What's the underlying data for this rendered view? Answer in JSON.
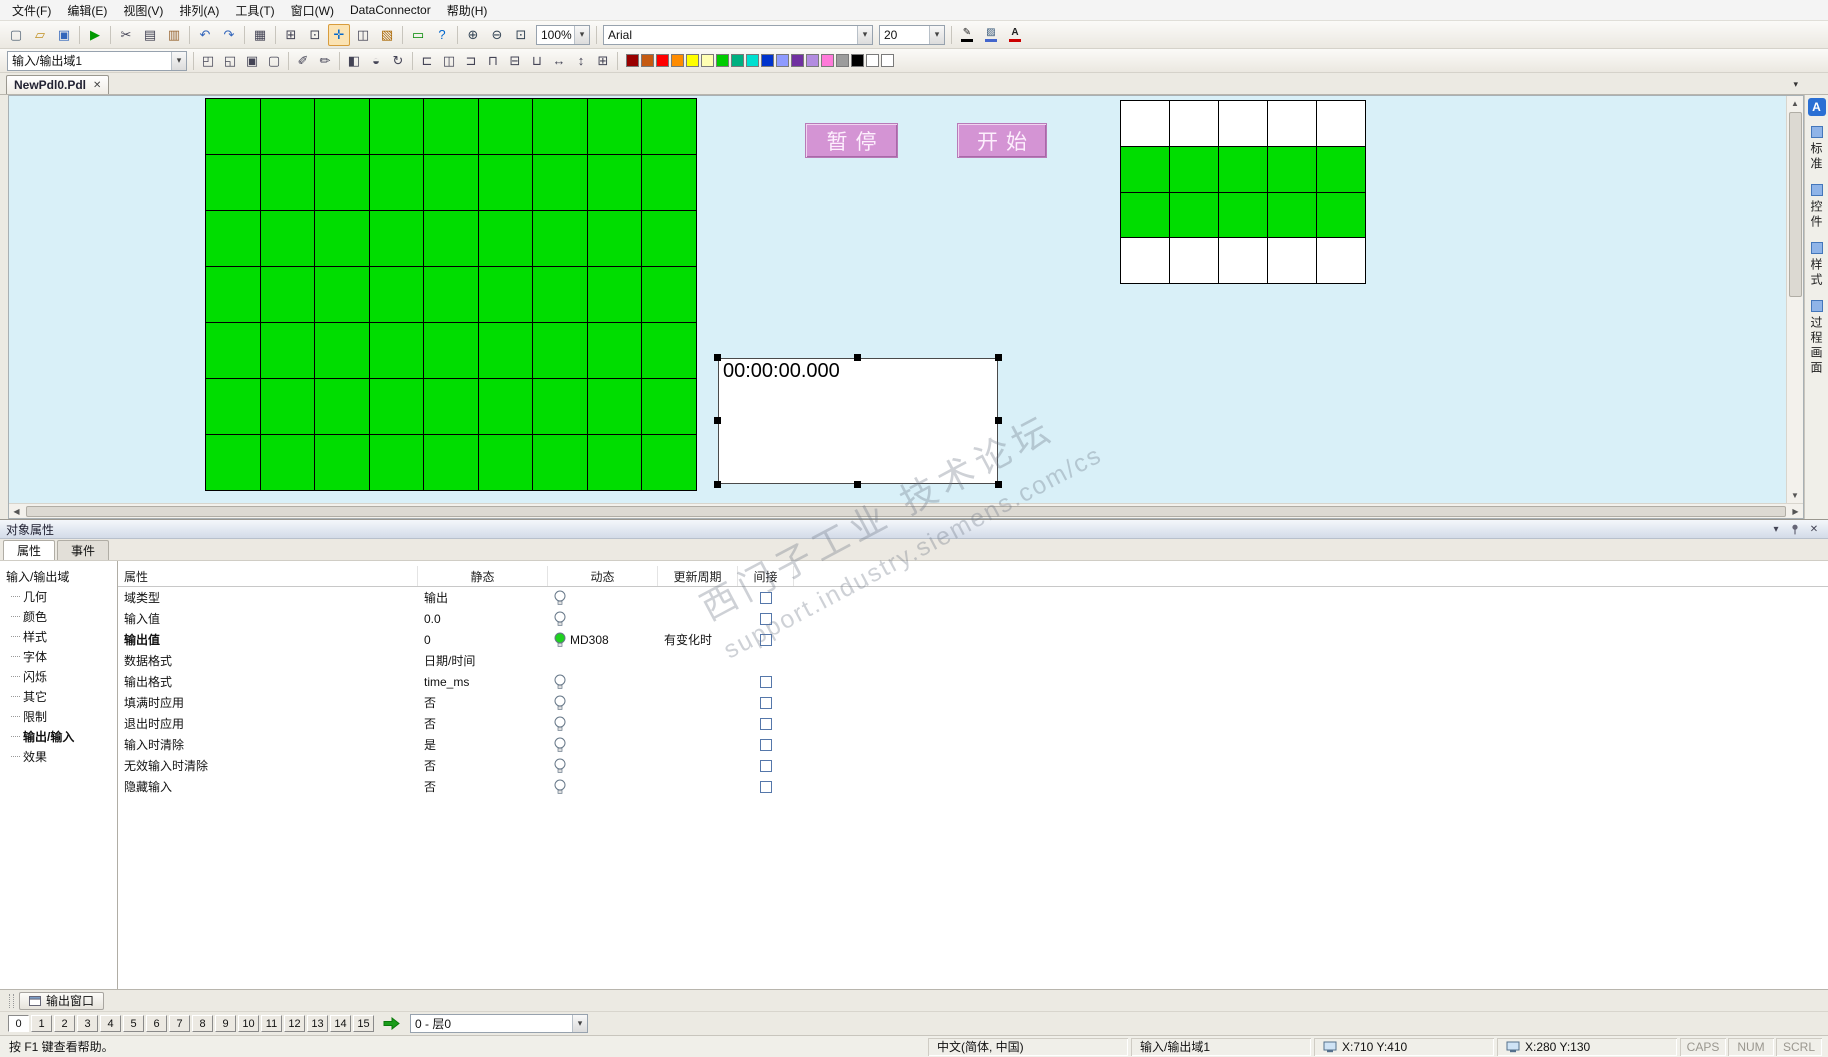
{
  "icons": {
    "close": "✕",
    "chevron_down": "▾",
    "scroll_up": "▲",
    "scroll_down": "▼",
    "scroll_left": "◀",
    "scroll_right": "▶",
    "standard_palette_letter": "A"
  },
  "menu_bar": {
    "items": [
      "文件(F)",
      "编辑(E)",
      "视图(V)",
      "排列(A)",
      "工具(T)",
      "窗口(W)",
      "DataConnector",
      "帮助(H)"
    ]
  },
  "toolbar_main": {
    "zoom_value": "100%",
    "font_name": "Arial",
    "font_size": "20",
    "icons": [
      {
        "n": "new-file-icon",
        "k": "new-file"
      },
      {
        "n": "open-file-icon",
        "k": "open-file"
      },
      {
        "n": "save-icon",
        "k": "save"
      },
      {
        "sep": 1
      },
      {
        "n": "run-icon",
        "k": "run"
      },
      {
        "sep": 1
      },
      {
        "n": "cut-icon",
        "k": "cut"
      },
      {
        "n": "copy-icon",
        "k": "copy"
      },
      {
        "n": "paste-icon",
        "k": "paste"
      },
      {
        "sep": 1
      },
      {
        "n": "undo-icon",
        "k": "undo"
      },
      {
        "n": "redo-icon",
        "k": "redo"
      },
      {
        "sep": 1
      },
      {
        "n": "print-icon",
        "k": "print"
      },
      {
        "sep": 1
      },
      {
        "n": "grid-icon",
        "k": "grid"
      },
      {
        "n": "snap-grid-icon",
        "k": "snap-grid"
      },
      {
        "n": "select-tool-icon",
        "k": "select-tool",
        "active": 1
      },
      {
        "n": "layout-panels-icon",
        "k": "panels"
      },
      {
        "n": "library-icon",
        "k": "library"
      },
      {
        "sep": 1
      },
      {
        "n": "tag-icon",
        "k": "tag"
      },
      {
        "n": "help-pointer-icon",
        "k": "help"
      },
      {
        "sep": 1
      },
      {
        "n": "zoom-in-icon",
        "k": "zoom-in"
      },
      {
        "n": "zoom-out-icon",
        "k": "zoom-out"
      },
      {
        "n": "zoom-area-icon",
        "k": "zoom-area"
      },
      {
        "combo": "zoom"
      },
      {
        "sep": 1
      },
      {
        "combo": "font"
      },
      {
        "combo": "size"
      },
      {
        "sep": 1
      },
      {
        "n": "line-color-icon",
        "k": "pen"
      },
      {
        "n": "fill-color-icon",
        "k": "fill"
      },
      {
        "n": "font-color-icon",
        "k": "font-color"
      }
    ]
  },
  "toolbar_object": {
    "selected_object": "输入/输出域1",
    "palette_colors": [
      "#990000",
      "#c55a11",
      "#ff0000",
      "#ff8c00",
      "#ffff00",
      "#ffffb3",
      "#00cc00",
      "#00b080",
      "#00e0d0",
      "#0033cc",
      "#8f9bff",
      "#7030a0",
      "#b38ce0",
      "#ff7ad9",
      "#9c9c9c",
      "#000000",
      "#ffffff",
      "#ffffff"
    ],
    "icons": [
      {
        "combo": "object"
      },
      {
        "sep": 1
      },
      {
        "n": "bring-front-icon",
        "k": "bring-front"
      },
      {
        "n": "send-back-icon",
        "k": "send-back"
      },
      {
        "n": "group-icon",
        "k": "group"
      },
      {
        "n": "ungroup-icon",
        "k": "ungroup"
      },
      {
        "sep": 1
      },
      {
        "n": "pipette-icon",
        "k": "pipette"
      },
      {
        "n": "brush-icon",
        "k": "brush"
      },
      {
        "sep": 1
      },
      {
        "n": "flip-horizontal-icon",
        "k": "flip-h"
      },
      {
        "n": "flip-vertical-icon",
        "k": "flip-v"
      },
      {
        "n": "rotate-icon",
        "k": "rotate"
      },
      {
        "sep": 1
      },
      {
        "n": "align-left-icon",
        "k": "align-left"
      },
      {
        "n": "align-center-icon",
        "k": "align-center"
      },
      {
        "n": "align-right-icon",
        "k": "align-right"
      },
      {
        "n": "align-top-icon",
        "k": "align-top"
      },
      {
        "n": "align-middle-icon",
        "k": "align-middle"
      },
      {
        "n": "align-bottom-icon",
        "k": "align-bottom"
      },
      {
        "n": "same-width-icon",
        "k": "same-width"
      },
      {
        "n": "same-height-icon",
        "k": "same-height"
      },
      {
        "n": "same-size-icon",
        "k": "same-size"
      },
      {
        "sep": 1
      },
      {
        "palette": 1
      }
    ]
  },
  "document_tab": {
    "title": "NewPdl0.Pdl"
  },
  "canvas": {
    "grid_color": "#00dd00",
    "main_grid": {
      "cols": 9,
      "rows": 7
    },
    "small_grid": {
      "cols": 5,
      "rows": 4,
      "green_rows": [
        1,
        2
      ]
    },
    "pause_button": "暂停",
    "start_button": "开始",
    "io_field_value": "00:00:00.000",
    "watermark_line1": "西门子工业 技术论坛",
    "watermark_line2": "support.industry.siemens.com/cs"
  },
  "side_tabs": [
    "标准",
    "控件",
    "样式",
    "过程画面"
  ],
  "properties_panel": {
    "title": "对象属性",
    "tabs": [
      {
        "label": "属性",
        "active": true
      },
      {
        "label": "事件",
        "active": false
      }
    ],
    "tree": {
      "root": "输入/输出域",
      "items": [
        {
          "label": "几何"
        },
        {
          "label": "颜色"
        },
        {
          "label": "样式"
        },
        {
          "label": "字体"
        },
        {
          "label": "闪烁"
        },
        {
          "label": "其它"
        },
        {
          "label": "限制"
        },
        {
          "label": "输出/输入",
          "selected": true
        },
        {
          "label": "效果"
        }
      ]
    },
    "table": {
      "headers": [
        "属性",
        "静态",
        "动态",
        "更新周期",
        "间接"
      ],
      "rows": [
        {
          "name": "域类型",
          "static": "输出",
          "dynamic": "bulb",
          "indirect": true
        },
        {
          "name": "输入值",
          "static": "0.0",
          "dynamic": "bulb",
          "indirect": true
        },
        {
          "name": "输出值",
          "static": "0",
          "dynamic": "bulb-green",
          "dynamic_text": "MD308",
          "cycle": "有变化时",
          "indirect": true,
          "bold": true
        },
        {
          "name": "数据格式",
          "static": "日期/时间",
          "dynamic": "",
          "indirect": false
        },
        {
          "name": "输出格式",
          "static": "time_ms",
          "dynamic": "bulb",
          "indirect": true
        },
        {
          "name": "填满时应用",
          "static": "否",
          "dynamic": "bulb",
          "indirect": true
        },
        {
          "name": "退出时应用",
          "static": "否",
          "dynamic": "bulb",
          "indirect": true
        },
        {
          "name": "输入时清除",
          "static": "是",
          "dynamic": "bulb",
          "indirect": true
        },
        {
          "name": "无效输入时清除",
          "static": "否",
          "dynamic": "bulb",
          "indirect": true
        },
        {
          "name": "隐藏输入",
          "static": "否",
          "dynamic": "bulb",
          "indirect": true
        }
      ]
    }
  },
  "output_bar": {
    "label": "输出窗口"
  },
  "layer_bar": {
    "layers": [
      "0",
      "1",
      "2",
      "3",
      "4",
      "5",
      "6",
      "7",
      "8",
      "9",
      "10",
      "11",
      "12",
      "13",
      "14",
      "15"
    ],
    "active": "0",
    "selected_layer": "0 - 层0"
  },
  "status_bar": {
    "help": "按 F1 键查看帮助。",
    "locale": "中文(简体, 中国)",
    "object": "输入/输出域1",
    "pos1": "X:710 Y:410",
    "pos2": "X:280 Y:130",
    "flags": [
      "CAPS",
      "NUM",
      "SCRL"
    ]
  }
}
